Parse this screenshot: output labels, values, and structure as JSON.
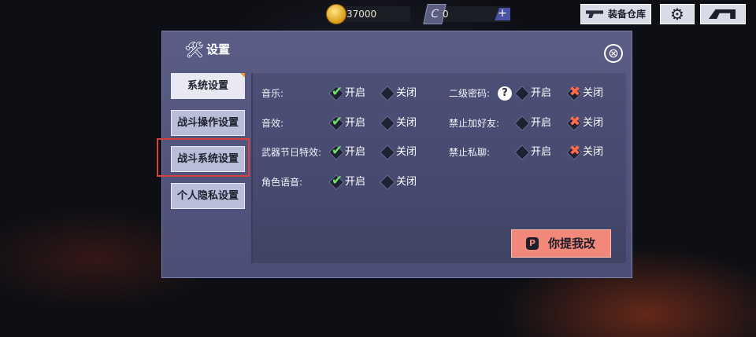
{
  "topbar": {
    "gold": "37000",
    "gems": "0",
    "gem_icon": "C",
    "plus": "+",
    "warehouse_label": "装备仓库",
    "gear_icon": "⚙"
  },
  "dialog": {
    "title": "设置",
    "title_icon": "🛠",
    "close_icon": "⊗",
    "tabs": [
      {
        "label": "系统设置",
        "active": true
      },
      {
        "label": "战斗操作设置",
        "active": false
      },
      {
        "label": "战斗系统设置",
        "active": false
      },
      {
        "label": "个人隐私设置",
        "active": false
      }
    ],
    "on_label": "开启",
    "off_label": "关闭",
    "left_settings": [
      {
        "label": "音乐:",
        "value": "on"
      },
      {
        "label": "音效:",
        "value": "on"
      },
      {
        "label": "武器节日特效:",
        "value": "on"
      },
      {
        "label": "角色语音:",
        "value": "on"
      }
    ],
    "right_settings": [
      {
        "label": "二级密码:",
        "value": "off",
        "help": "?"
      },
      {
        "label": "禁止加好友:",
        "value": "off"
      },
      {
        "label": "禁止私聊:",
        "value": "off"
      }
    ],
    "feedback_label": "你提我改",
    "feedback_icon": "P"
  },
  "colors": {
    "accent_on": "#6fe06a",
    "accent_off": "#ff6a4a",
    "feedback_bg": "#f28879",
    "highlight_border": "#d8403a"
  }
}
